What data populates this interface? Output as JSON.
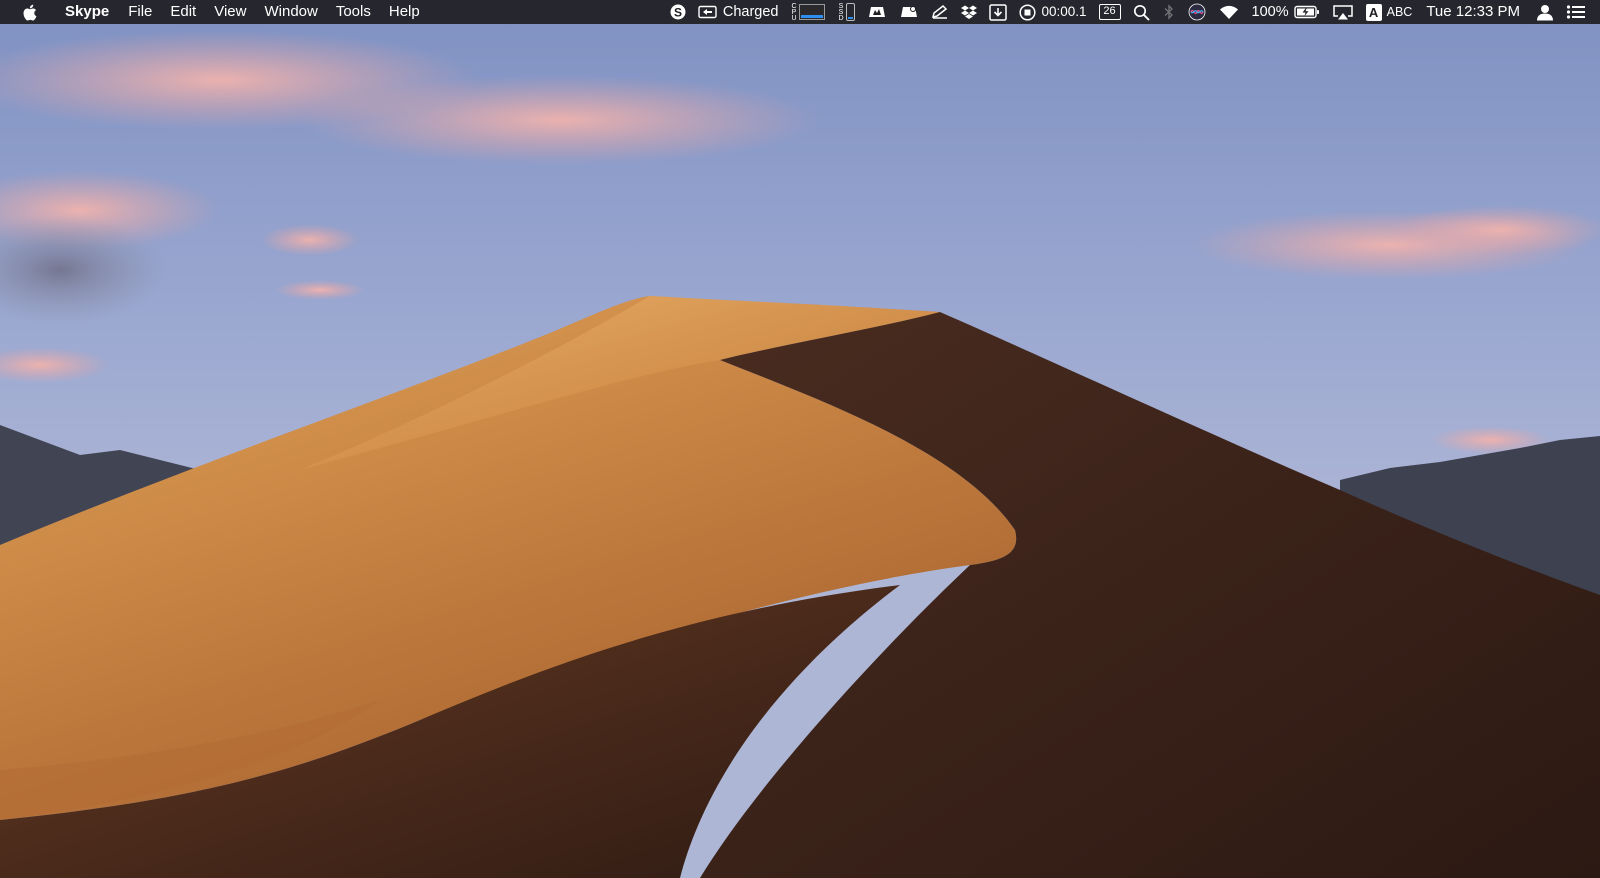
{
  "menubar": {
    "app_name": "Skype",
    "menus": [
      "File",
      "Edit",
      "View",
      "Window",
      "Tools",
      "Help"
    ],
    "icons": {
      "apple": "apple-logo-icon",
      "skype": "skype-icon",
      "battery_status": "charging-icon",
      "notify_1": "notification-icon",
      "notify_2": "notification-icon",
      "edit": "pen-icon",
      "dropbox": "dropbox-icon",
      "download": "download-icon",
      "record": "record-icon",
      "search": "search-icon",
      "bluetooth": "bluetooth-icon",
      "siri": "siri-icon",
      "wifi": "wifi-icon",
      "battery": "battery-icon",
      "airplay": "airplay-icon",
      "user": "user-icon",
      "notification_center": "list-icon"
    },
    "status": {
      "charge_text": "Charged",
      "cpu_label": "CPU",
      "ssd_label": "SSD",
      "cpu_level": 0.2,
      "ssd_level": 0.15,
      "timer": "00:00.1",
      "calendar_day": "26",
      "battery_percent": "100%",
      "input_badge": "A",
      "input_source": "ABC",
      "clock": "Tue 12:33 PM"
    },
    "colors": {
      "bar": "#1e1e22",
      "accent": "#2b8ef0",
      "text": "#ffffff"
    }
  },
  "wallpaper": {
    "name": "desert-dune-wallpaper",
    "colors": {
      "sky_top": "#8798c6",
      "sky_bottom": "#a9b3d6",
      "cloud": "#e8a9a6",
      "mountain": "#3f4350",
      "sand_light": "#d4944d",
      "sand_mid": "#b06b33",
      "sand_shadow": "#3a2219"
    }
  }
}
